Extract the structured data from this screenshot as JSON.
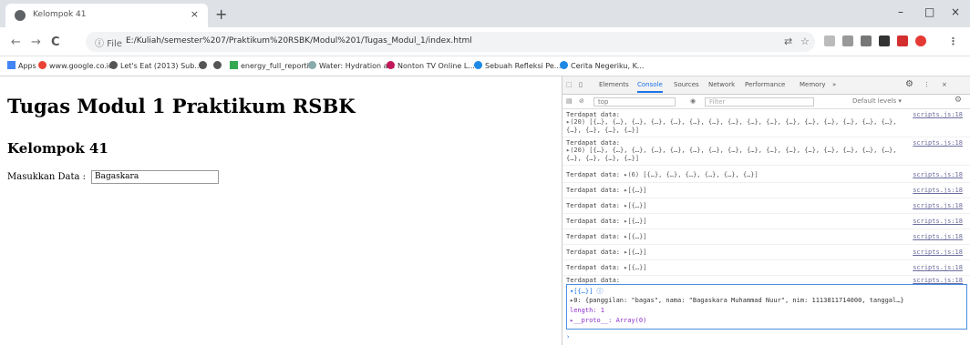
{
  "browser": {
    "tab_title": "Kelompok 41",
    "tab_close": "×",
    "new_tab": "+",
    "win_min": "–",
    "win_max": "□",
    "win_close": "×",
    "back": "←",
    "forward": "→",
    "reload": "C",
    "info": "ⓘ File",
    "url": "E:/Kuliah/semester%207/Praktikum%20RSBK/Modul%201/Tugas_Modul_1/index.html"
  },
  "bookmarks": [
    {
      "label": "Apps",
      "color": "#4285f4"
    },
    {
      "label": "www.google.co.id",
      "color": "#ea4335"
    },
    {
      "label": "Let's Eat (2013) Sub...",
      "color": "#555555"
    },
    {
      "label": "",
      "color": "#555555"
    },
    {
      "label": "",
      "color": "#555555"
    },
    {
      "label": "energy_full_reporti...",
      "color": "#34a853"
    },
    {
      "label": "Water: Hydration a...",
      "color": "#555555"
    },
    {
      "label": "Nonton TV Online L...",
      "color": "#c2185b"
    },
    {
      "label": "Sebuah Refleksi Pe...",
      "color": "#1e88e5"
    },
    {
      "label": "Cerita Negeriku, K...",
      "color": "#1e88e5"
    }
  ],
  "page": {
    "heading": "Tugas Modul 1 Praktikum RSBK",
    "subheading": "Kelompok 41",
    "input_label": "Masukkan Data :",
    "input_value": "Bagaskara"
  },
  "devtools": {
    "tabs": [
      "Elements",
      "Console",
      "Sources",
      "Network",
      "Performance",
      "Memory",
      "»"
    ],
    "filter_context": "top",
    "filter_placeholder": "Filter",
    "levels": "Default levels ▾",
    "logs": [
      {
        "text": "Terdapat data:",
        "detail": "▸(20) [{…}, {…}, {…}, {…}, {…}, {…}, {…}, {…}, {…}, {…}, {…}, {…}, {…}, {…}, {…}, {…}, {…}, {…}, {…}, {…}]",
        "src": "scripts.js:18"
      },
      {
        "text": "Terdapat data:",
        "detail": "▸(20) [{…}, {…}, {…}, {…}, {…}, {…}, {…}, {…}, {…}, {…}, {…}, {…}, {…}, {…}, {…}, {…}, {…}, {…}, {…}, {…}]",
        "src": "scripts.js:18"
      },
      {
        "text": "Terdapat data:",
        "detail": "▸(6) [{…}, {…}, {…}, {…}, {…}, {…}]",
        "src": "scripts.js:18"
      },
      {
        "text": "Terdapat data:",
        "detail": "▸[{…}]",
        "src": "scripts.js:18"
      },
      {
        "text": "Terdapat data:",
        "detail": "▸[{…}]",
        "src": "scripts.js:18"
      },
      {
        "text": "Terdapat data:",
        "detail": "▸[{…}]",
        "src": "scripts.js:18"
      },
      {
        "text": "Terdapat data:",
        "detail": "▸[{…}]",
        "src": "scripts.js:18"
      },
      {
        "text": "Terdapat data:",
        "detail": "▸[{…}]",
        "src": "scripts.js:18"
      },
      {
        "text": "Terdapat data:",
        "detail": "▸[{…}]",
        "src": "scripts.js:18"
      },
      {
        "text": "Terdapat data:",
        "detail": "",
        "src": "scripts.js:18"
      }
    ],
    "expanded": [
      "▾[{…}] ⓘ",
      "  ▸0: {panggilan: \"bagas\", nama: \"Bagaskara Muhammad Nuur\", nim: 1113811714000, tanggal…}",
      "    length: 1",
      "  ▸__proto__: Array(0)"
    ],
    "prompt": "›"
  }
}
